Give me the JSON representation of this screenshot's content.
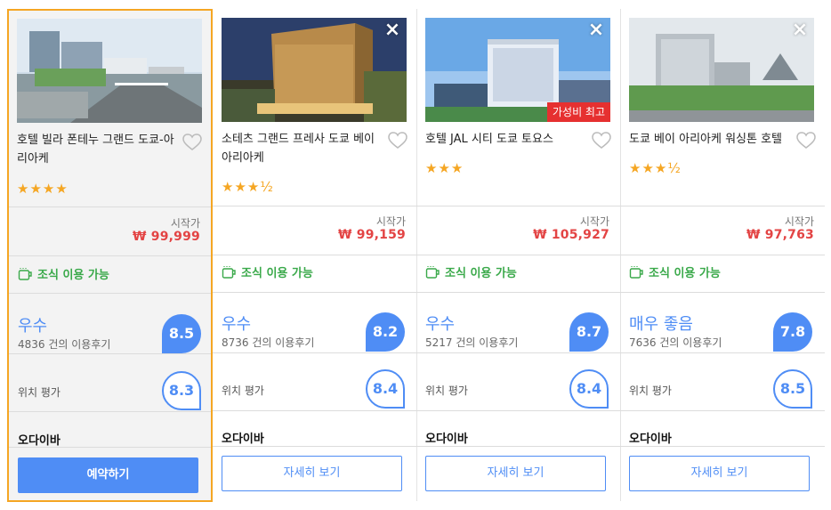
{
  "colors": {
    "accent": "#4f8df5",
    "price": "#e34444",
    "breakfast": "#3aa94a",
    "selected_border": "#f5a623",
    "badge": "#e63030"
  },
  "hotels": [
    {
      "name": "호텔 빌라 폰테누 그랜드 도쿄-아리아케",
      "stars": "★★★★",
      "price_label": "시작가",
      "price": "₩ 99,999",
      "breakfast": "조식 이용 가능",
      "rating_word": "우수",
      "reviews": "4836 건의 이용후기",
      "score": "8.5",
      "location_label": "위치 평가",
      "location_score": "8.3",
      "provider": "오다이바",
      "button": "예약하기"
    },
    {
      "name": "소테츠 그랜드 프레사 도쿄 베이 아리아케",
      "stars": "★★★½",
      "price_label": "시작가",
      "price": "₩ 99,159",
      "breakfast": "조식 이용 가능",
      "rating_word": "우수",
      "reviews": "8736 건의 이용후기",
      "score": "8.2",
      "location_label": "위치 평가",
      "location_score": "8.4",
      "provider": "오다이바",
      "button": "자세히 보기",
      "close": "×"
    },
    {
      "name": "호텔 JAL 시티 도쿄 토요스",
      "stars": "★★★",
      "badge": "가성비 최고",
      "price_label": "시작가",
      "price": "₩ 105,927",
      "breakfast": "조식 이용 가능",
      "rating_word": "우수",
      "reviews": "5217 건의 이용후기",
      "score": "8.7",
      "location_label": "위치 평가",
      "location_score": "8.4",
      "provider": "오다이바",
      "button": "자세히 보기",
      "close": "×"
    },
    {
      "name": "도쿄 베이 아리아케 워싱톤 호텔",
      "stars": "★★★½",
      "price_label": "시작가",
      "price": "₩ 97,763",
      "breakfast": "조식 이용 가능",
      "rating_word": "매우 좋음",
      "reviews": "7636 건의 이용후기",
      "score": "7.8",
      "location_label": "위치 평가",
      "location_score": "8.5",
      "provider": "오다이바",
      "button": "자세히 보기",
      "close": "×"
    }
  ]
}
